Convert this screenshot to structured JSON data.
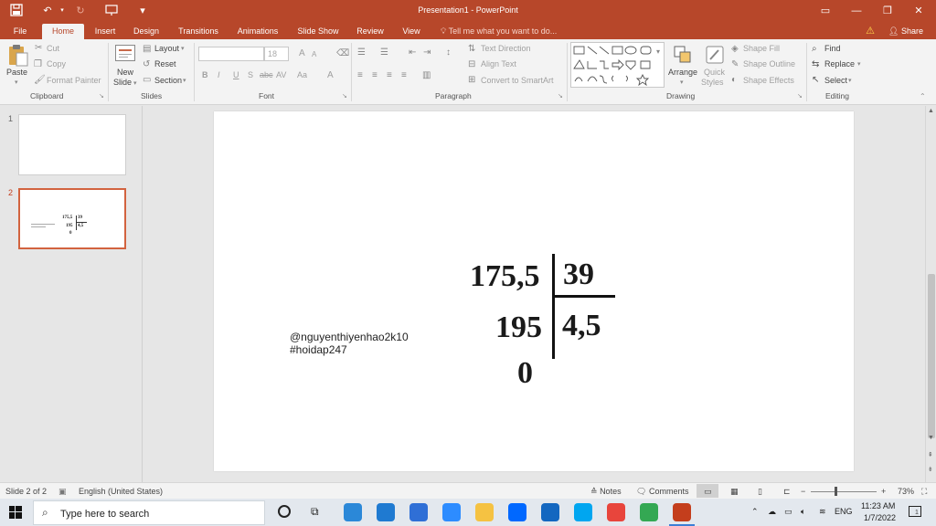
{
  "titlebar": {
    "title": "Presentation1 - PowerPoint",
    "icons": [
      "save-icon",
      "undo-icon",
      "redo-icon",
      "present-icon",
      "customize-icon"
    ],
    "window_buttons": [
      "ribbon-display-icon",
      "minimize-icon",
      "restore-icon",
      "close-icon"
    ]
  },
  "tabs": [
    {
      "label": "File"
    },
    {
      "label": "Home",
      "active": true
    },
    {
      "label": "Insert"
    },
    {
      "label": "Design"
    },
    {
      "label": "Transitions"
    },
    {
      "label": "Animations"
    },
    {
      "label": "Slide Show"
    },
    {
      "label": "Review"
    },
    {
      "label": "View"
    }
  ],
  "tellme": {
    "text": "Tell me what you want to do..."
  },
  "share": {
    "label": "Share"
  },
  "ribbon": {
    "clipboard": {
      "paste": "Paste",
      "cut": "Cut",
      "copy": "Copy",
      "format_painter": "Format Painter",
      "label": "Clipboard"
    },
    "slides": {
      "new_slide_1": "New",
      "new_slide_2": "Slide",
      "layout": "Layout",
      "reset": "Reset",
      "section": "Section",
      "label": "Slides"
    },
    "font": {
      "font_size": "18",
      "label": "Font",
      "bold": "B",
      "italic": "I",
      "underline": "U",
      "shadow": "S",
      "strike": "abc",
      "spacing": "AV",
      "case": "Aa",
      "grow": "A",
      "shrink": "A",
      "color": "A"
    },
    "paragraph": {
      "text_direction": "Text Direction",
      "align_text": "Align Text",
      "convert_smartart": "Convert to SmartArt",
      "label": "Paragraph"
    },
    "drawing": {
      "arrange": "Arrange",
      "quick_styles_1": "Quick",
      "quick_styles_2": "Styles",
      "shape_fill": "Shape Fill",
      "shape_outline": "Shape Outline",
      "shape_effects": "Shape Effects",
      "label": "Drawing"
    },
    "editing": {
      "find": "Find",
      "replace": "Replace",
      "select": "Select",
      "label": "Editing"
    }
  },
  "thumbnails": [
    {
      "number": "1"
    },
    {
      "number": "2",
      "selected": true,
      "dividend": "175,5",
      "divisor": "39",
      "subtract": "195",
      "quotient": "4,5",
      "remainder": "0"
    }
  ],
  "slide": {
    "watermark_1": "@nguyenthiyenhao2k10",
    "watermark_2": "#hoidap247",
    "division": {
      "dividend": "175,5",
      "divisor": "39",
      "partial": "195",
      "quotient": "4,5",
      "remainder": "0"
    }
  },
  "statusbar": {
    "slide_info": "Slide 2 of 2",
    "language": "English (United States)",
    "notes": "Notes",
    "comments": "Comments",
    "zoom": "73%"
  },
  "taskbar": {
    "search_placeholder": "Type here to search",
    "language": "ENG",
    "time": "11:23 AM",
    "date": "1/7/2022",
    "notifications": "1",
    "apps": [
      {
        "name": "edge-icon",
        "color": "#2b88d8"
      },
      {
        "name": "onedrive-icon",
        "color": "#1f7ad1"
      },
      {
        "name": "store-icon",
        "color": "#2f6fd6"
      },
      {
        "name": "zoom-icon",
        "color": "#2d8cff"
      },
      {
        "name": "explorer-icon",
        "color": "#f5c242"
      },
      {
        "name": "zalo-icon",
        "color": "#0068ff"
      },
      {
        "name": "mail-icon",
        "color": "#1367c0"
      },
      {
        "name": "skype-icon",
        "color": "#00a6f0"
      },
      {
        "name": "chrome-icon",
        "color": "#e8453c"
      },
      {
        "name": "chrome-profile-icon",
        "color": "#34a853"
      },
      {
        "name": "powerpoint-icon",
        "color": "#c43e1c"
      }
    ]
  },
  "colors": {
    "accent": "#b7472a",
    "selection": "#d2633f"
  }
}
